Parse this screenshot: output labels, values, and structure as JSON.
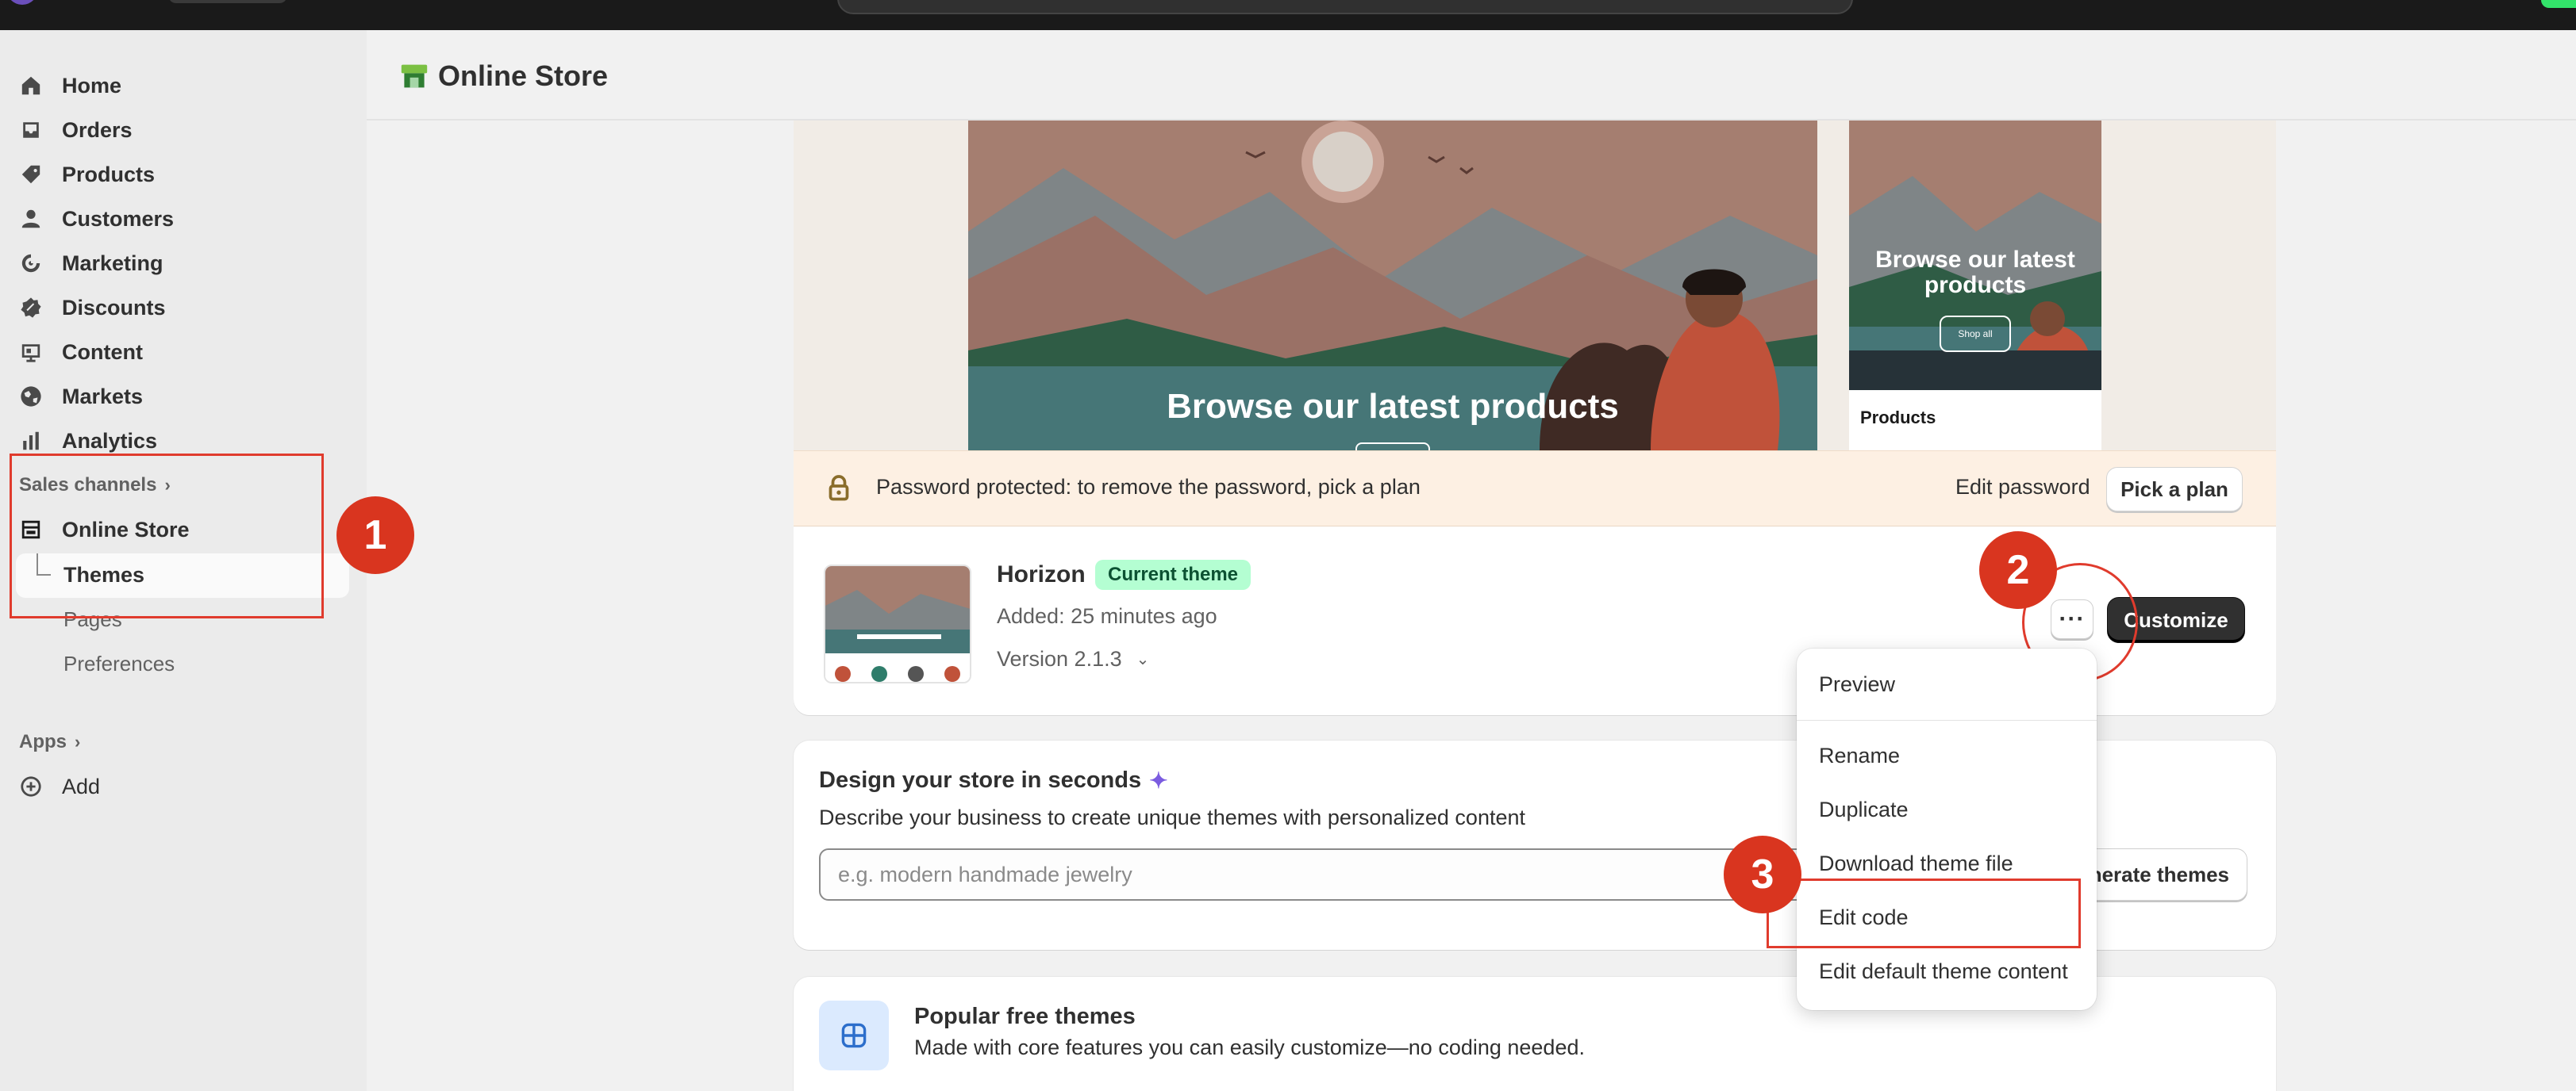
{
  "header": {
    "title": "Online Store"
  },
  "sidebar": {
    "items": [
      {
        "label": "Home",
        "icon": "home-icon"
      },
      {
        "label": "Orders",
        "icon": "inbox-icon"
      },
      {
        "label": "Products",
        "icon": "tag-icon"
      },
      {
        "label": "Customers",
        "icon": "person-icon"
      },
      {
        "label": "Marketing",
        "icon": "target-icon"
      },
      {
        "label": "Discounts",
        "icon": "discount-icon"
      },
      {
        "label": "Content",
        "icon": "content-icon"
      },
      {
        "label": "Markets",
        "icon": "globe-icon"
      },
      {
        "label": "Analytics",
        "icon": "bar-chart-icon"
      }
    ],
    "sales_channels_label": "Sales channels",
    "online_store_label": "Online Store",
    "sub_items": [
      "Themes",
      "Pages",
      "Preferences"
    ],
    "apps_label": "Apps",
    "add_label": "Add"
  },
  "preview": {
    "desktop_headline": "Browse our latest products",
    "mobile_headline": "Browse our latest products",
    "mobile_button": "Shop all",
    "mobile_products_label": "Products"
  },
  "password_bar": {
    "message": "Password protected: to remove the password, pick a plan",
    "edit_password": "Edit password",
    "pick_plan": "Pick a plan"
  },
  "theme": {
    "name": "Horizon",
    "badge": "Current theme",
    "added": "Added: 25 minutes ago",
    "version": "Version 2.1.3",
    "more_label": "···",
    "customize_label": "Customize"
  },
  "menu": {
    "items": [
      "Preview",
      "Rename",
      "Duplicate",
      "Download theme file",
      "Edit code",
      "Edit default theme content"
    ]
  },
  "design": {
    "title": "Design your store in seconds",
    "description": "Describe your business to create unique themes with personalized content",
    "placeholder": "e.g. modern handmade jewelry",
    "button": "enerate themes"
  },
  "popular": {
    "title": "Popular free themes",
    "description": "Made with core features you can easily customize—no coding needed."
  },
  "annotations": [
    "1",
    "2",
    "3"
  ],
  "colors": {
    "annotation_red": "#d9351f",
    "badge_green": "#b4fed2",
    "customize_dark": "#303030",
    "password_bar_bg": "#fdf0e3"
  }
}
